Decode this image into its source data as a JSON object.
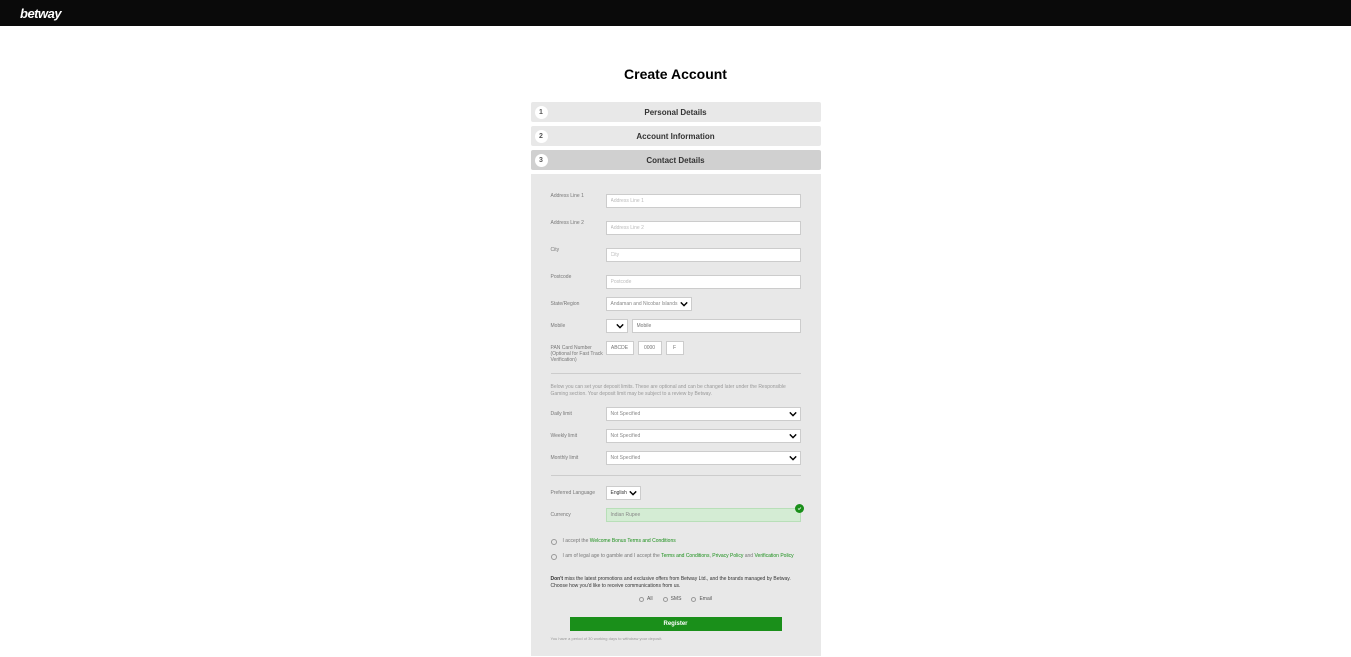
{
  "header": {
    "logo": "betway"
  },
  "page": {
    "title": "Create Account"
  },
  "steps": {
    "step1": {
      "number": "1",
      "title": "Personal Details"
    },
    "step2": {
      "number": "2",
      "title": "Account Information"
    },
    "step3": {
      "number": "3",
      "title": "Contact Details"
    }
  },
  "form": {
    "address1": {
      "label": "Address Line 1",
      "placeholder": "Address Line 1"
    },
    "address2": {
      "label": "Address Line 2",
      "placeholder": "Address Line 2"
    },
    "city": {
      "label": "City",
      "placeholder": "City"
    },
    "postcode": {
      "label": "Postcode",
      "placeholder": "Postcode"
    },
    "state": {
      "label": "State/Region",
      "value": "Andaman and Nicobar Islands"
    },
    "mobile": {
      "label": "Mobile",
      "placeholder": "Mobile"
    },
    "pan": {
      "label": "PAN Card Number (Optional for Fast Track Verification)",
      "p1": "ABCDE",
      "p2": "0000",
      "p3": "F"
    },
    "limits_desc": "Below you can set your deposit limits. These are optional and can be changed later under the Responsible Gaming section. Your deposit limit may be subject to a review by Betway.",
    "daily": {
      "label": "Daily limit",
      "value": "Not Specified"
    },
    "weekly": {
      "label": "Weekly limit",
      "value": "Not Specified"
    },
    "monthly": {
      "label": "Monthly limit",
      "value": "Not Specified"
    },
    "language": {
      "label": "Preferred Language",
      "value": "English"
    },
    "currency": {
      "label": "Currency",
      "value": "Indian Rupee"
    },
    "check1": {
      "prefix": "I accept the ",
      "link": "Welcome Bonus Terms and Conditions"
    },
    "check2": {
      "prefix": "I am of legal age to gamble and I accept the ",
      "link1": "Terms and Conditions",
      "mid": ", ",
      "link2": "Privacy Policy",
      "and": " and ",
      "link3": "Verification Policy"
    },
    "promo": {
      "bold": "Don't ",
      "text": "miss the latest promotions and exclusive offers from Betway Ltd., and the brands managed by Betway. Choose how you'd like to receive communications from us."
    },
    "radios": {
      "all": "All",
      "sms": "SMS",
      "email": "Email"
    },
    "register": "Register",
    "footer": "You have a period of 30 working days to withdraw your deposit."
  }
}
